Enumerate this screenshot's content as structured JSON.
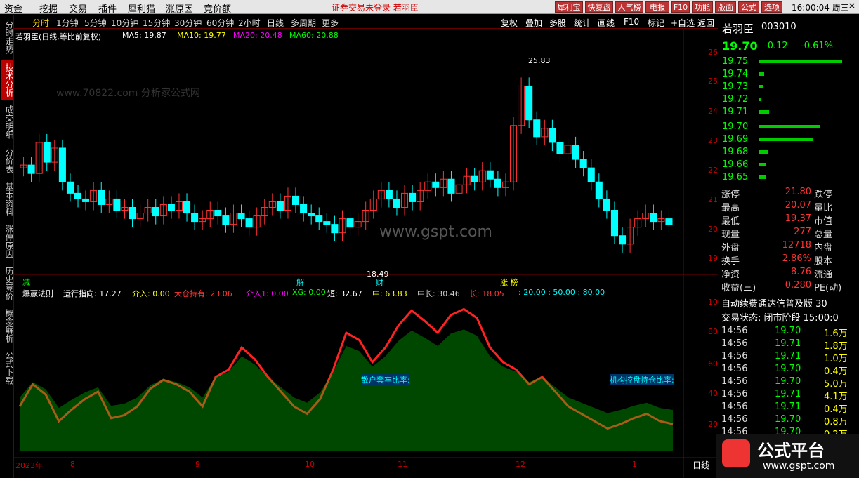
{
  "menu": [
    "资金",
    "挖掘",
    "交易",
    "插件",
    "犀利猫",
    "涨原因",
    "竞价额"
  ],
  "banner": "证券交易未登录 若羽臣",
  "toolbar_buttons": [
    "犀利宝",
    "快复盘",
    "人气榜",
    "电报",
    "F10",
    "功能",
    "版面",
    "公式",
    "选项"
  ],
  "clock": "16:00:04 周三",
  "left_tabs": [
    "分时走势",
    "技术分析",
    "成交明细",
    "分价表",
    "基本资料",
    "涨停原因",
    "历史竞价",
    "概念解析",
    "公式下载"
  ],
  "periods": [
    "分时",
    "1分钟",
    "5分钟",
    "10分钟",
    "15分钟",
    "30分钟",
    "60分钟",
    "2小时",
    "日线",
    "多周期",
    "更多"
  ],
  "right_tools": [
    "复权",
    "叠加",
    "多股",
    "统计",
    "画线",
    "F10",
    "标记",
    "+自选",
    "返回"
  ],
  "main_legend": {
    "title": "若羽臣(日线,等比前复权)",
    "ma5": "MA5: 19.87",
    "ma10": "MA10: 19.77",
    "ma20": "MA20: 20.48",
    "ma60": "MA60: 20.88"
  },
  "price_ticks": [
    "26.00",
    "25.00",
    "24.00",
    "23.00",
    "22.00",
    "21.00",
    "20.00",
    "19.00"
  ],
  "high_label": "25.83",
  "low_label": "18.49",
  "event_markers": [
    "减",
    "解",
    "财",
    "涨 榜"
  ],
  "watermark": "www.70822.com 分析家公式网",
  "gspt": "www.gspt.com",
  "ind_legend": {
    "name": "爆赢法则",
    "yx": "运行指向: 17.27",
    "jr": "介入: 0.00",
    "dc": "大仓持有: 23.06",
    "jr1": "介入1: 0.00",
    "xg": "XG: 0.00",
    "duan": "短: 32.67",
    "zhong": "中: 63.83",
    "zc": "中长: 30.46",
    "chang": "长: 18.05",
    "levels": ": 20.00 : 50.00 : 80.00"
  },
  "ind_ticks": [
    "100.0",
    "80.00",
    "60.00",
    "40.00",
    "20.00"
  ],
  "ind_labels": [
    "散户套牢比率:",
    "机构控盘持仓比率:"
  ],
  "date_axis": [
    "2023年",
    "8",
    "9",
    "10",
    "11",
    "12",
    "1"
  ],
  "bottom_tab": "日线",
  "stock": {
    "name": "若羽臣",
    "code": "003010",
    "price": "19.70",
    "chg": "-0.12",
    "pct": "-0.61%"
  },
  "asks": [
    [
      "19.75",
      0.85
    ],
    [
      "19.74",
      0.06
    ],
    [
      "19.73",
      0.04
    ],
    [
      "19.72",
      0.03
    ],
    [
      "19.71",
      0.11
    ]
  ],
  "bids": [
    [
      "19.70",
      0.62
    ],
    [
      "19.69",
      0.55
    ],
    [
      "19.68",
      0.09
    ],
    [
      "19.66",
      0.08
    ],
    [
      "19.65",
      0.08
    ]
  ],
  "stats": [
    [
      "涨停",
      "21.80",
      "跌停",
      ""
    ],
    [
      "最高",
      "20.07",
      "量比",
      ""
    ],
    [
      "最低",
      "19.37",
      "市值",
      ""
    ],
    [
      "现量",
      "277",
      "总量",
      ""
    ],
    [
      "外盘",
      "12718",
      "内盘",
      ""
    ],
    [
      "换手",
      "2.86%",
      "股本",
      ""
    ],
    [
      "净资",
      "8.76",
      "流通",
      ""
    ],
    [
      "收益(三)",
      "0.280",
      "PE(动)",
      ""
    ]
  ],
  "promo": "自动续费通达信普及版 30",
  "state": "交易状态: 闭市阶段 15:00:0",
  "ticks": [
    [
      "14:56",
      "19.70",
      "1.6万"
    ],
    [
      "14:56",
      "19.71",
      "1.8万"
    ],
    [
      "14:56",
      "19.71",
      "1.0万"
    ],
    [
      "14:56",
      "19.70",
      "0.4万"
    ],
    [
      "14:56",
      "19.70",
      "5.0万"
    ],
    [
      "14:56",
      "19.71",
      "4.1万"
    ],
    [
      "14:56",
      "19.71",
      "0.4万"
    ],
    [
      "14:56",
      "19.70",
      "0.8万"
    ],
    [
      "14:56",
      "19.70",
      "0.2万"
    ]
  ],
  "corner_logo": "公式平台",
  "corner_url": "www.gspt.com",
  "colors": {
    "up": "#ff3333",
    "down": "#00ffff",
    "ma20": "#cc33cc",
    "ma60": "#33cc33",
    "accent": "#b00000"
  },
  "chart_data": {
    "type": "candlestick",
    "ylim": [
      18.2,
      26.4
    ],
    "closes": [
      21.8,
      21.5,
      22.6,
      21.9,
      22.4,
      21.2,
      20.8,
      20.6,
      20.5,
      20.9,
      20.4,
      20.6,
      20.2,
      20.3,
      19.9,
      20.1,
      20.3,
      20.0,
      20.4,
      20.2,
      20.5,
      20.1,
      19.8,
      19.9,
      20.2,
      20.0,
      19.7,
      20.1,
      19.9,
      19.6,
      20.0,
      20.3,
      20.5,
      20.2,
      20.7,
      20.4,
      20.1,
      20.0,
      19.8,
      19.7,
      19.4,
      19.9,
      19.6,
      19.8,
      20.2,
      20.6,
      20.9,
      20.6,
      20.3,
      20.8,
      20.5,
      20.9,
      21.2,
      21.0,
      21.3,
      20.8,
      21.1,
      21.4,
      21.2,
      21.6,
      21.3,
      21.0,
      21.2,
      23.2,
      24.6,
      23.4,
      22.8,
      23.1,
      22.6,
      22.2,
      22.5,
      22.0,
      21.7,
      21.2,
      20.6,
      20.2,
      19.3,
      19.0,
      19.6,
      19.9,
      20.1,
      19.8,
      19.9,
      19.7
    ],
    "ind_series": [
      {
        "name": "大仓持有",
        "values": [
          30,
          45,
          38,
          20,
          28,
          35,
          40,
          22,
          24,
          30,
          42,
          48,
          45,
          40,
          30,
          50,
          55,
          70,
          62,
          50,
          40,
          30,
          25,
          35,
          55,
          80,
          75,
          60,
          70,
          85,
          95,
          88,
          80,
          92,
          96,
          90,
          70,
          60,
          55,
          45,
          50,
          40,
          30,
          25,
          20,
          15,
          18,
          22,
          25,
          20,
          18
        ]
      }
    ]
  }
}
